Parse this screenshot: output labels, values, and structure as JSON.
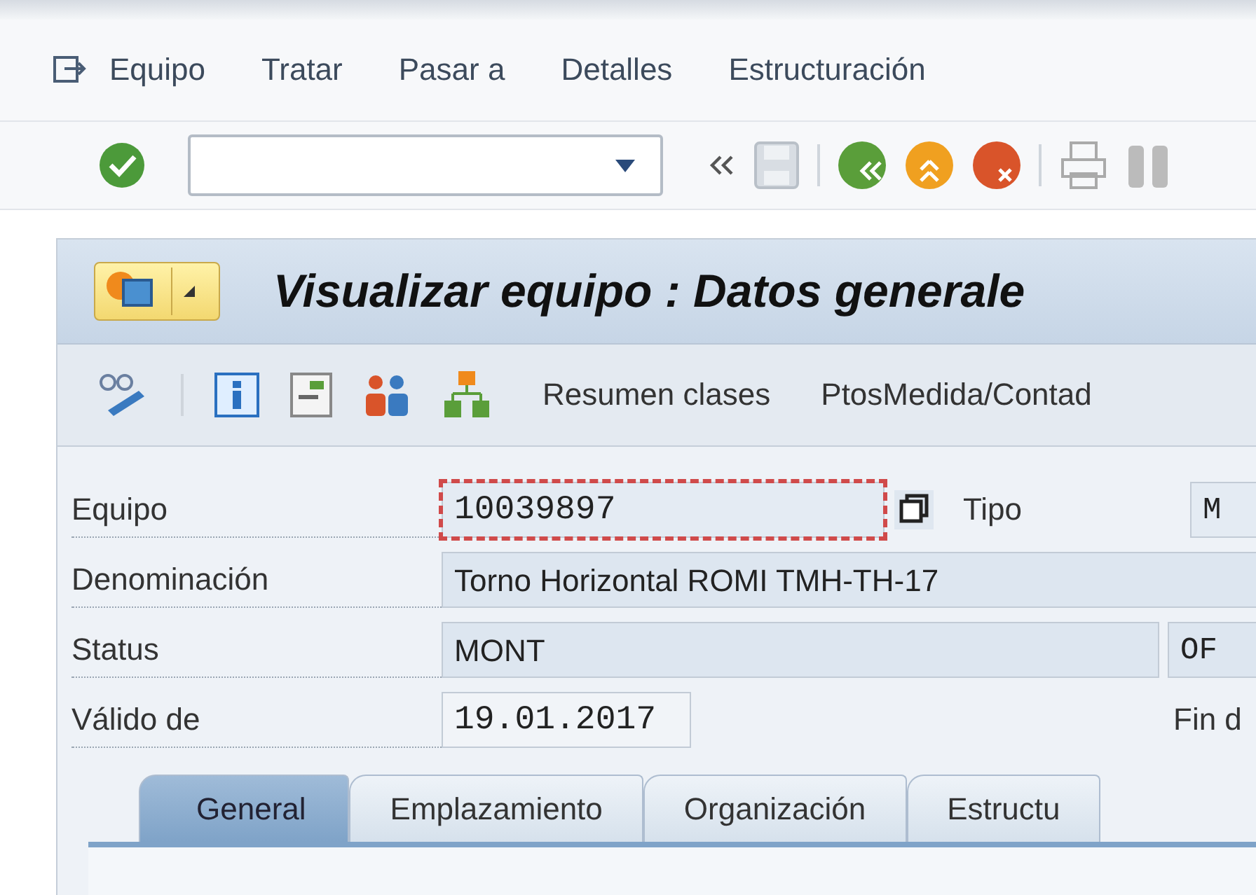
{
  "menu_bar": {
    "items": [
      "Equipo",
      "Tratar",
      "Pasar a",
      "Detalles",
      "Estructuración"
    ]
  },
  "screen": {
    "title": "Visualizar equipo : Datos generale",
    "app_toolbar": {
      "buttons": [
        "Resumen clases",
        "PtosMedida/Contad"
      ]
    }
  },
  "form": {
    "rows": [
      {
        "kind": "key",
        "label": "Equipo",
        "value": "10039897",
        "focused": true,
        "side_label": "Tipo",
        "side_value": "M"
      },
      {
        "kind": "text",
        "label": "Denominación",
        "value": "Torno Horizontal ROMI TMH-TH-17",
        "focused": false
      },
      {
        "kind": "status",
        "label": "Status",
        "value": "MONT",
        "focused": false,
        "side_value": "OF"
      },
      {
        "kind": "date",
        "label": "Válido de",
        "value": "19.01.2017",
        "focused": false,
        "side_label": "Fin d"
      }
    ]
  },
  "tabs": [
    {
      "label": "General",
      "selected": true
    },
    {
      "label": "Emplazamiento",
      "selected": false
    },
    {
      "label": "Organización",
      "selected": false
    },
    {
      "label": "Estructu",
      "selected": false
    }
  ]
}
